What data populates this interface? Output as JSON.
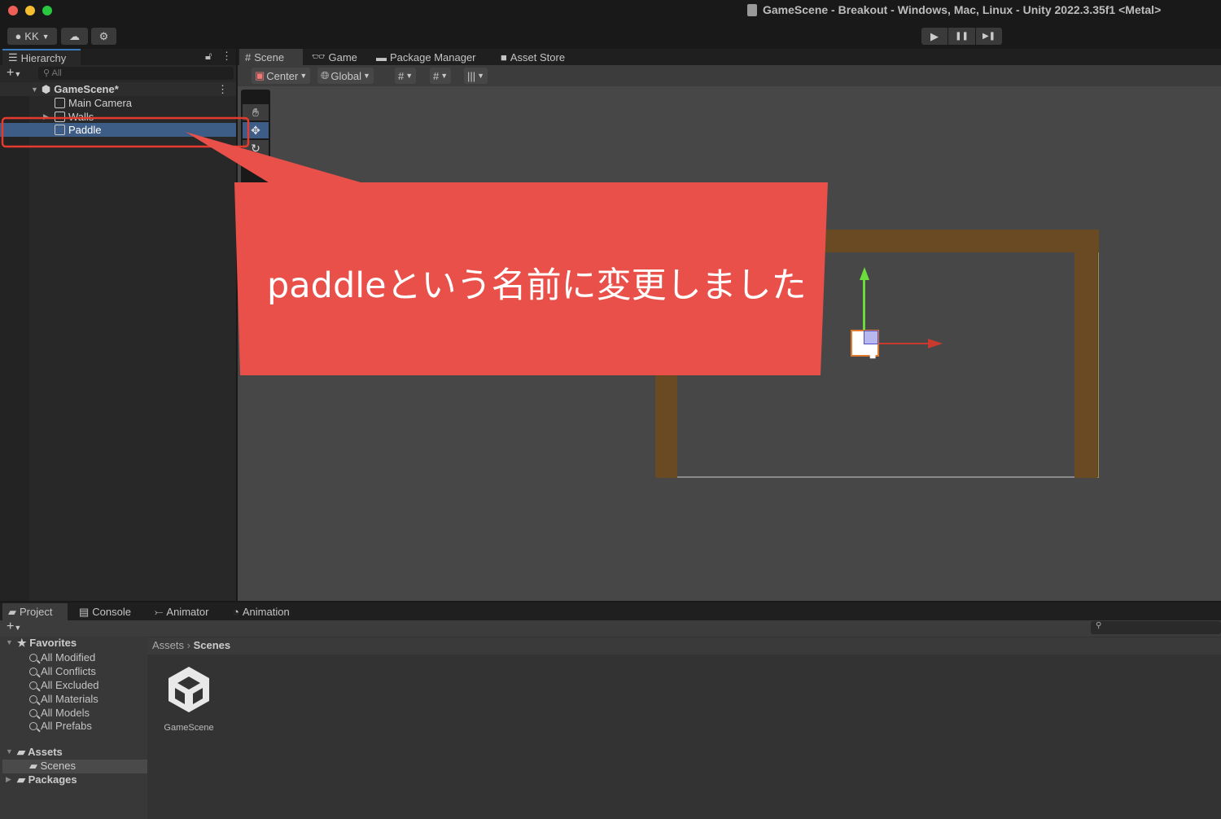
{
  "window": {
    "title": "GameScene - Breakout - Windows, Mac, Linux - Unity 2022.3.35f1 <Metal>"
  },
  "toolbar": {
    "account": "KK",
    "play": "▶",
    "pause": "❚❚",
    "step": "▶❚"
  },
  "hierarchy": {
    "tab": "Hierarchy",
    "search_placeholder": "All",
    "scene": "GameScene*",
    "items": [
      {
        "label": "Main Camera"
      },
      {
        "label": "Walls"
      },
      {
        "label": "Paddle",
        "selected": true
      }
    ]
  },
  "scene_tabs": [
    {
      "label": "Scene",
      "active": true
    },
    {
      "label": "Game"
    },
    {
      "label": "Package Manager"
    },
    {
      "label": "Asset Store"
    }
  ],
  "scene_toolbar": {
    "pivot": "Center",
    "space": "Global"
  },
  "annotation": {
    "text": "paddleという名前に変更しました",
    "color": "#e9504a"
  },
  "project": {
    "tabs": [
      {
        "label": "Project",
        "active": true
      },
      {
        "label": "Console"
      },
      {
        "label": "Animator"
      },
      {
        "label": "Animation"
      }
    ],
    "favorites_label": "Favorites",
    "favorites": [
      "All Modified",
      "All Conflicts",
      "All Excluded",
      "All Materials",
      "All Models",
      "All Prefabs"
    ],
    "assets_label": "Assets",
    "scenes_label": "Scenes",
    "packages_label": "Packages",
    "breadcrumb": [
      "Assets",
      "Scenes"
    ],
    "files": [
      {
        "name": "GameScene"
      }
    ]
  },
  "colors": {
    "wall": "#6a4a22",
    "selection": "#3d5c86",
    "accent": "#e53b2f"
  }
}
